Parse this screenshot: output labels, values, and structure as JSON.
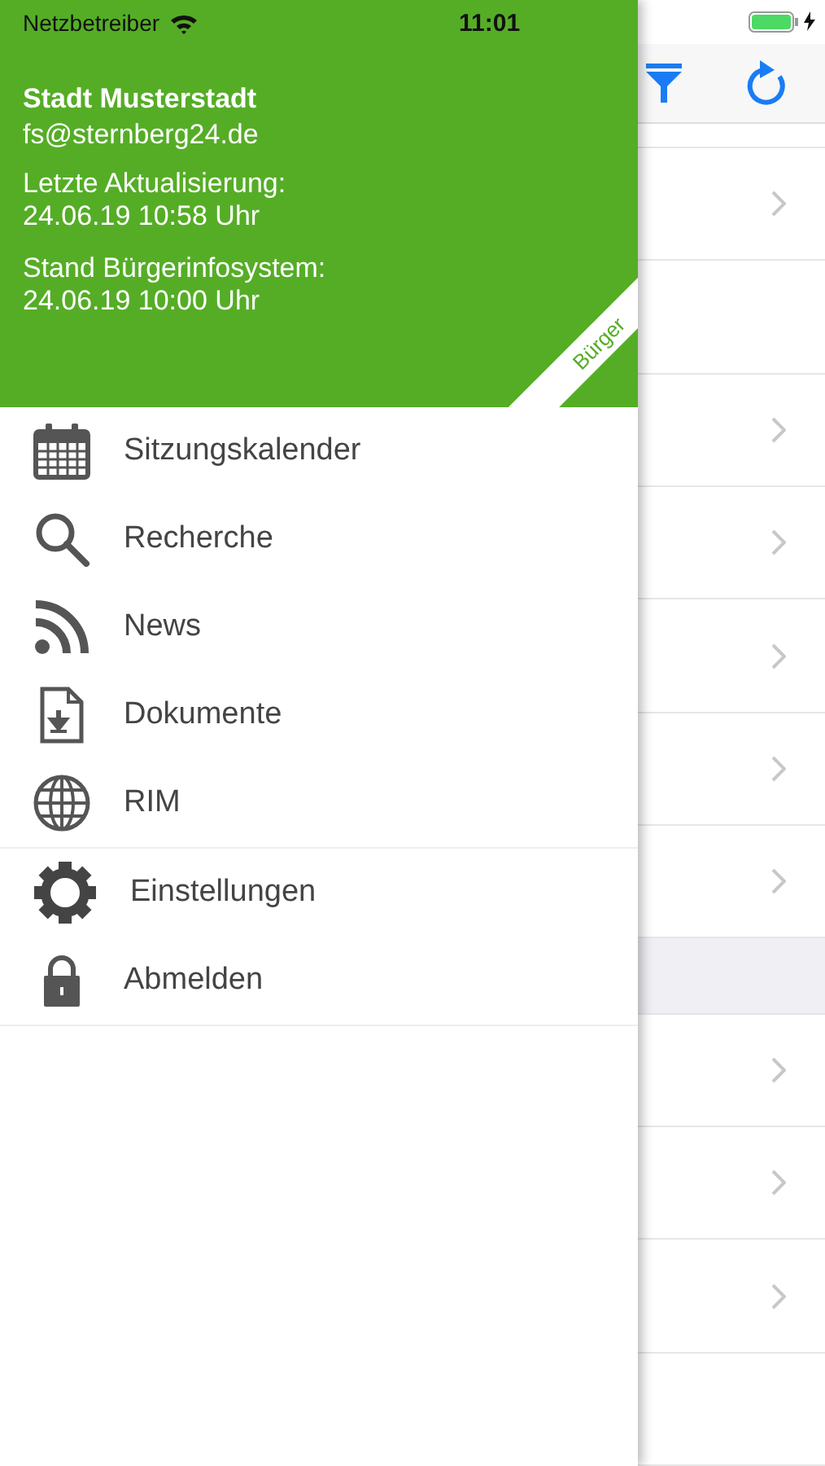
{
  "status_bar": {
    "carrier": "Netzbetreiber",
    "time": "11:01",
    "charging": true
  },
  "drawer": {
    "header": {
      "title": "Stadt Musterstadt",
      "email": "fs@sternberg24.de",
      "last_update_label": "Letzte Aktualisierung:",
      "last_update_value": "24.06.19 10:58 Uhr",
      "system_label": "Stand Bürgerinfosystem:",
      "system_value": "24.06.19 10:00 Uhr",
      "ribbon": "Bürger"
    },
    "menu_groups": [
      {
        "items": [
          {
            "label": "Sitzungskalender",
            "kind": "calendar"
          },
          {
            "label": "Recherche",
            "kind": "search"
          },
          {
            "label": "News",
            "kind": "feed"
          },
          {
            "label": "Dokumente",
            "kind": "document"
          },
          {
            "label": "RIM",
            "kind": "globe"
          }
        ]
      },
      {
        "items": [
          {
            "label": "Einstellungen",
            "kind": "settings"
          },
          {
            "label": "Abmelden",
            "kind": "lock"
          }
        ]
      }
    ]
  },
  "background_list": {
    "rows": [
      {
        "kind": "chevron"
      },
      {
        "kind": "plain"
      },
      {
        "kind": "chevron"
      },
      {
        "kind": "chevron"
      },
      {
        "kind": "chevron"
      },
      {
        "kind": "chevron"
      },
      {
        "kind": "chevron"
      },
      {
        "kind": "section"
      },
      {
        "kind": "chevron"
      },
      {
        "kind": "chevron"
      },
      {
        "kind": "chevron"
      },
      {
        "kind": "plain"
      }
    ]
  }
}
